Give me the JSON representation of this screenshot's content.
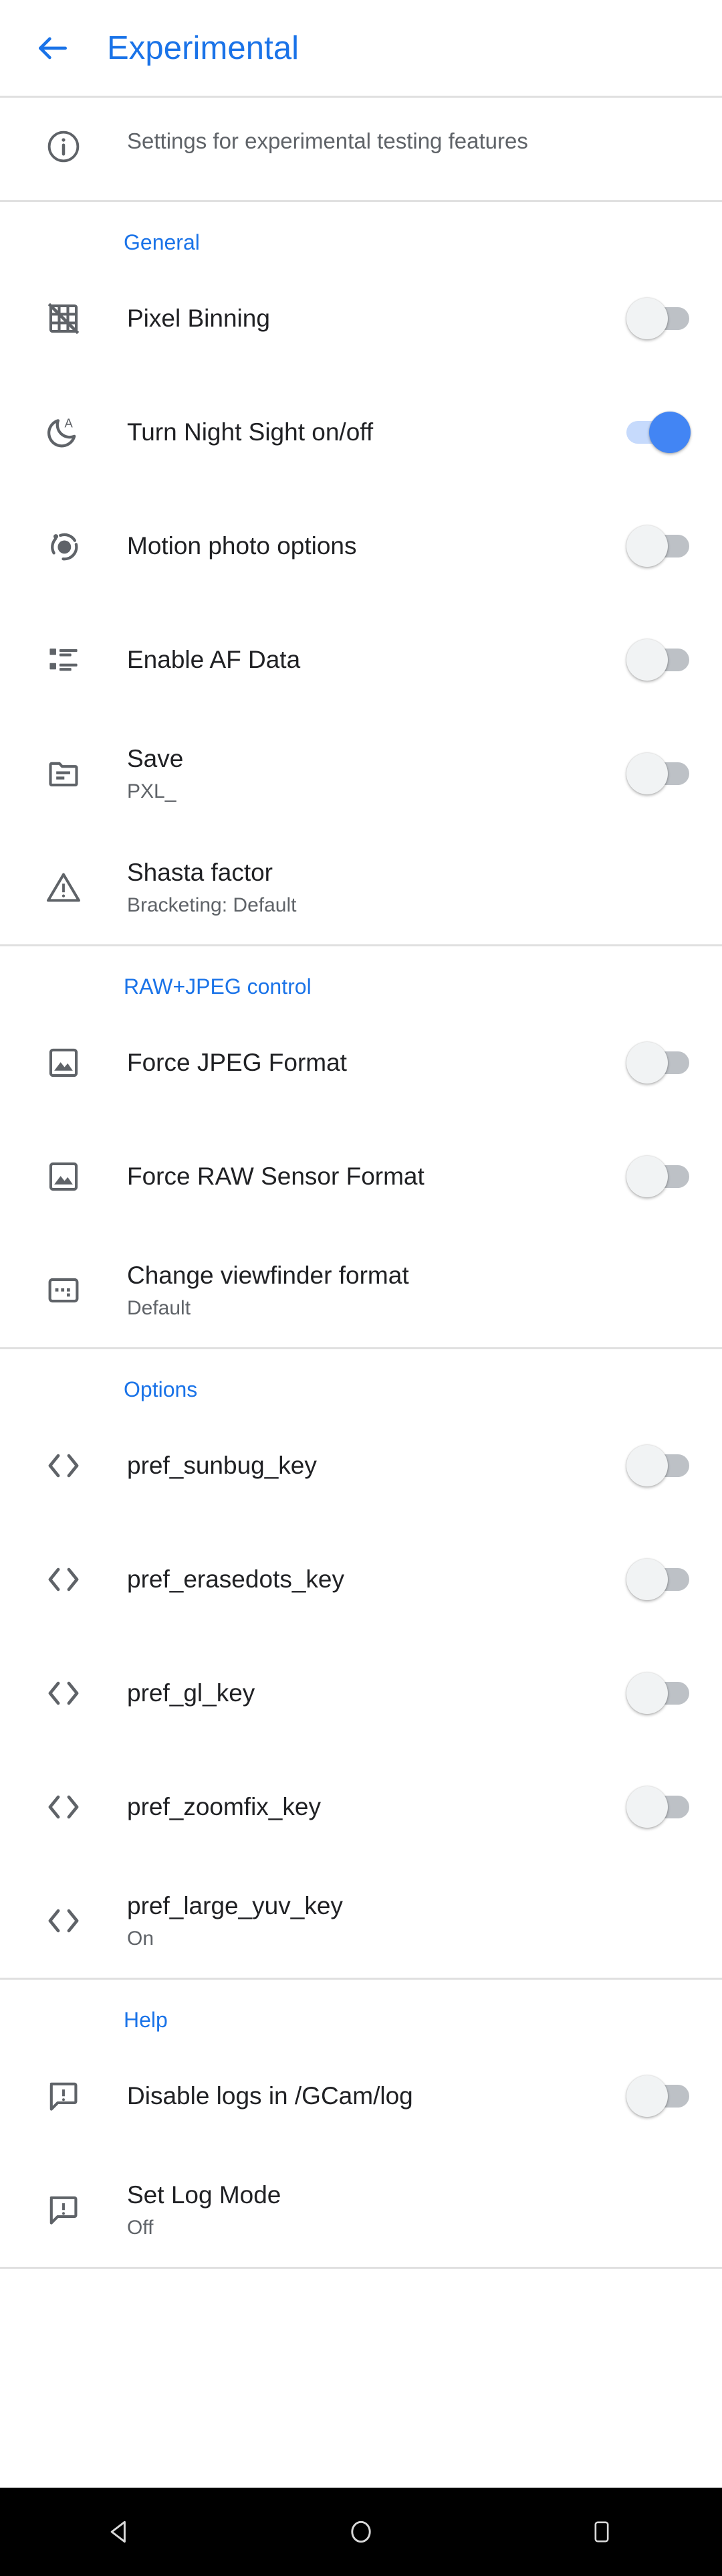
{
  "appbar": {
    "back_icon": "arrow-left-icon",
    "title": "Experimental",
    "title_color": "#1a73e8"
  },
  "info_banner": {
    "icon": "info-circle-icon",
    "text": "Settings for experimental testing features"
  },
  "sections": [
    {
      "id": "general",
      "title": "General",
      "rows": [
        {
          "icon": "grid-off-icon",
          "title": "Pixel Binning",
          "subtitle": "",
          "control": "switch",
          "switch_state": "off"
        },
        {
          "icon": "night-sight-auto-icon",
          "title": "Turn Night Sight on/off",
          "subtitle": "",
          "control": "switch",
          "switch_state": "on"
        },
        {
          "icon": "motion-photo-icon",
          "title": "Motion photo options",
          "subtitle": "",
          "control": "switch",
          "switch_state": "off"
        },
        {
          "icon": "af-data-list-icon",
          "title": "Enable AF Data",
          "subtitle": "",
          "control": "switch",
          "switch_state": "off"
        },
        {
          "icon": "folder-document-icon",
          "title": "Save",
          "subtitle": "PXL_",
          "control": "switch",
          "switch_state": "off"
        },
        {
          "icon": "warning-triangle-icon",
          "title": "Shasta factor",
          "subtitle": "Bracketing: Default",
          "control": "none",
          "switch_state": ""
        }
      ]
    },
    {
      "id": "raw-jpeg-control",
      "title": "RAW+JPEG control",
      "rows": [
        {
          "icon": "image-icon",
          "title": "Force JPEG Format",
          "subtitle": "",
          "control": "switch",
          "switch_state": "off"
        },
        {
          "icon": "image-icon",
          "title": "Force RAW Sensor Format",
          "subtitle": "",
          "control": "switch",
          "switch_state": "off"
        },
        {
          "icon": "viewfinder-format-icon",
          "title": "Change viewfinder format",
          "subtitle": "Default",
          "control": "none",
          "switch_state": ""
        }
      ]
    },
    {
      "id": "options",
      "title": "Options",
      "rows": [
        {
          "icon": "code-brackets-icon",
          "title": "pref_sunbug_key",
          "subtitle": "",
          "control": "switch",
          "switch_state": "off"
        },
        {
          "icon": "code-brackets-icon",
          "title": "pref_erasedots_key",
          "subtitle": "",
          "control": "switch",
          "switch_state": "off"
        },
        {
          "icon": "code-brackets-icon",
          "title": "pref_gl_key",
          "subtitle": "",
          "control": "switch",
          "switch_state": "off"
        },
        {
          "icon": "code-brackets-icon",
          "title": "pref_zoomfix_key",
          "subtitle": "",
          "control": "switch",
          "switch_state": "off"
        },
        {
          "icon": "code-brackets-icon",
          "title": "pref_large_yuv_key",
          "subtitle": "On",
          "control": "none",
          "switch_state": ""
        }
      ]
    },
    {
      "id": "help",
      "title": "Help",
      "rows": [
        {
          "icon": "log-comment-icon",
          "title": "Disable logs in /GCam/log",
          "subtitle": "",
          "control": "switch",
          "switch_state": "off"
        },
        {
          "icon": "log-comment-icon",
          "title": "Set Log Mode",
          "subtitle": "Off",
          "control": "none",
          "switch_state": ""
        }
      ]
    }
  ],
  "navbar": {
    "back": "nav-back-triangle-icon",
    "home": "nav-home-circle-icon",
    "recents": "nav-recents-square-icon"
  },
  "colors": {
    "accent_blue": "#1a73e8",
    "switch_on_thumb": "#4285f4",
    "switch_on_track": "#c6dafc",
    "switch_off_thumb": "#f1f3f4",
    "switch_off_track": "#bdc1c6",
    "icon_gray": "#5f6368",
    "primary_text": "#202124",
    "secondary_text": "#5f6368",
    "divider": "#e0e0e0",
    "navbar_bg": "#000000"
  }
}
